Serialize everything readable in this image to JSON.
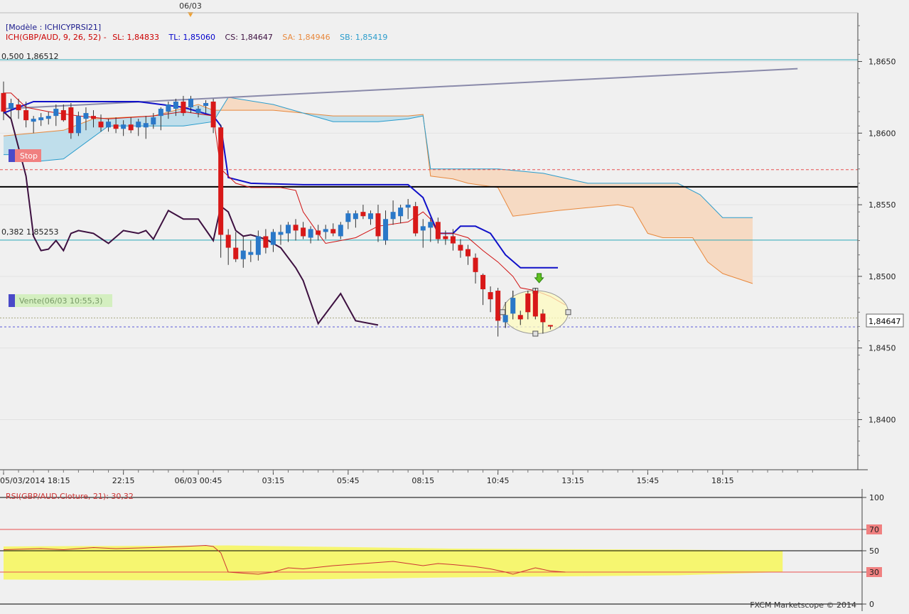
{
  "header": {
    "date_marker": "06/03",
    "model_label": "[Modèle : ICHICYPRSI21]",
    "ich_prefix": "ICH(GBP/AUD, 9, 26, 52) -",
    "sl": "SL: 1,84833",
    "tl": "TL: 1,85060",
    "cs": "CS: 1,84647",
    "sa": "SA: 1,84946",
    "sb": "SB: 1,85419"
  },
  "fib_levels": [
    {
      "label": "0,500 1,86512",
      "price": 1.86512
    },
    {
      "label": "0,382 1,85253",
      "price": 1.85253
    }
  ],
  "tags": {
    "stop": "Stop",
    "vente": "Vente(06/03 10:55,3)"
  },
  "chart_data": {
    "type": "candlestick",
    "y_axis": {
      "ticks": [
        "1,8650",
        "1,8600",
        "1,8550",
        "1,8500",
        "1,8450",
        "1,8400"
      ],
      "tick_values": [
        1.865,
        1.86,
        1.855,
        1.85,
        1.845,
        1.84
      ],
      "current_price_label": "1,84647",
      "current_price": 1.84647,
      "range": [
        1.8365,
        1.8684
      ]
    },
    "x_axis": {
      "ticks": [
        "05/03/2014 18:15",
        "22:15",
        "06/03 00:45",
        "03:15",
        "05:45",
        "08:15",
        "10:45",
        "13:15",
        "15:45",
        "18:15"
      ],
      "tick_index": [
        0,
        16,
        26,
        36,
        46,
        56,
        66,
        76,
        86,
        96
      ]
    },
    "levels": {
      "stop": 1.85745,
      "black_line": 1.85625,
      "vente": 1.8471,
      "current": 1.84647
    },
    "candles": [
      {
        "o": 1.8628,
        "h": 1.8636,
        "l": 1.8609,
        "c": 1.8615
      },
      {
        "o": 1.8617,
        "h": 1.8624,
        "l": 1.8609,
        "c": 1.8621
      },
      {
        "o": 1.862,
        "h": 1.8624,
        "l": 1.861,
        "c": 1.8616
      },
      {
        "o": 1.8616,
        "h": 1.8622,
        "l": 1.8604,
        "c": 1.8609
      },
      {
        "o": 1.8608,
        "h": 1.8612,
        "l": 1.86,
        "c": 1.861
      },
      {
        "o": 1.8609,
        "h": 1.8614,
        "l": 1.8605,
        "c": 1.8611
      },
      {
        "o": 1.861,
        "h": 1.8615,
        "l": 1.8606,
        "c": 1.8612
      },
      {
        "o": 1.8612,
        "h": 1.862,
        "l": 1.8605,
        "c": 1.8617
      },
      {
        "o": 1.8616,
        "h": 1.862,
        "l": 1.8608,
        "c": 1.8609
      },
      {
        "o": 1.8618,
        "h": 1.8621,
        "l": 1.8596,
        "c": 1.86
      },
      {
        "o": 1.86,
        "h": 1.8615,
        "l": 1.8598,
        "c": 1.8612
      },
      {
        "o": 1.861,
        "h": 1.8618,
        "l": 1.8602,
        "c": 1.8614
      },
      {
        "o": 1.8612,
        "h": 1.8616,
        "l": 1.8604,
        "c": 1.861
      },
      {
        "o": 1.8608,
        "h": 1.8613,
        "l": 1.8601,
        "c": 1.8604
      },
      {
        "o": 1.8604,
        "h": 1.861,
        "l": 1.8601,
        "c": 1.8608
      },
      {
        "o": 1.8606,
        "h": 1.8611,
        "l": 1.86,
        "c": 1.8603
      },
      {
        "o": 1.8603,
        "h": 1.8609,
        "l": 1.8598,
        "c": 1.8606
      },
      {
        "o": 1.8606,
        "h": 1.8611,
        "l": 1.86,
        "c": 1.8602
      },
      {
        "o": 1.8604,
        "h": 1.861,
        "l": 1.8598,
        "c": 1.8608
      },
      {
        "o": 1.8604,
        "h": 1.8612,
        "l": 1.8596,
        "c": 1.8607
      },
      {
        "o": 1.8606,
        "h": 1.8614,
        "l": 1.8603,
        "c": 1.8611
      },
      {
        "o": 1.8612,
        "h": 1.8618,
        "l": 1.8602,
        "c": 1.8617
      },
      {
        "o": 1.8615,
        "h": 1.8622,
        "l": 1.861,
        "c": 1.862
      },
      {
        "o": 1.8617,
        "h": 1.8624,
        "l": 1.8612,
        "c": 1.8622
      },
      {
        "o": 1.8622,
        "h": 1.8626,
        "l": 1.8612,
        "c": 1.8614
      },
      {
        "o": 1.8618,
        "h": 1.8626,
        "l": 1.8614,
        "c": 1.8624
      },
      {
        "o": 1.8614,
        "h": 1.8619,
        "l": 1.8611,
        "c": 1.8617
      },
      {
        "o": 1.8619,
        "h": 1.8623,
        "l": 1.8614,
        "c": 1.8621
      },
      {
        "o": 1.8622,
        "h": 1.8624,
        "l": 1.86,
        "c": 1.8604
      },
      {
        "o": 1.8604,
        "h": 1.8606,
        "l": 1.8513,
        "c": 1.8529
      },
      {
        "o": 1.8529,
        "h": 1.8533,
        "l": 1.8508,
        "c": 1.852
      },
      {
        "o": 1.852,
        "h": 1.8531,
        "l": 1.851,
        "c": 1.8512
      },
      {
        "o": 1.8512,
        "h": 1.8528,
        "l": 1.8506,
        "c": 1.8518
      },
      {
        "o": 1.8515,
        "h": 1.8525,
        "l": 1.851,
        "c": 1.8517
      },
      {
        "o": 1.8515,
        "h": 1.8532,
        "l": 1.8511,
        "c": 1.8528
      },
      {
        "o": 1.8528,
        "h": 1.8533,
        "l": 1.8516,
        "c": 1.852
      },
      {
        "o": 1.8522,
        "h": 1.8533,
        "l": 1.8517,
        "c": 1.8531
      },
      {
        "o": 1.8529,
        "h": 1.8536,
        "l": 1.8522,
        "c": 1.8531
      },
      {
        "o": 1.853,
        "h": 1.8538,
        "l": 1.8524,
        "c": 1.8536
      },
      {
        "o": 1.8536,
        "h": 1.854,
        "l": 1.8525,
        "c": 1.8532
      },
      {
        "o": 1.8534,
        "h": 1.8538,
        "l": 1.8526,
        "c": 1.8528
      },
      {
        "o": 1.8527,
        "h": 1.8535,
        "l": 1.8523,
        "c": 1.8533
      },
      {
        "o": 1.8532,
        "h": 1.8536,
        "l": 1.8525,
        "c": 1.8529
      },
      {
        "o": 1.8531,
        "h": 1.8536,
        "l": 1.8526,
        "c": 1.8533
      },
      {
        "o": 1.8533,
        "h": 1.8537,
        "l": 1.8528,
        "c": 1.853
      },
      {
        "o": 1.8528,
        "h": 1.8538,
        "l": 1.8526,
        "c": 1.8536
      },
      {
        "o": 1.8538,
        "h": 1.8546,
        "l": 1.8533,
        "c": 1.8544
      },
      {
        "o": 1.854,
        "h": 1.8546,
        "l": 1.8534,
        "c": 1.8544
      },
      {
        "o": 1.8545,
        "h": 1.855,
        "l": 1.854,
        "c": 1.8542
      },
      {
        "o": 1.854,
        "h": 1.8546,
        "l": 1.8536,
        "c": 1.8544
      },
      {
        "o": 1.8544,
        "h": 1.855,
        "l": 1.8524,
        "c": 1.8528
      },
      {
        "o": 1.8525,
        "h": 1.8546,
        "l": 1.8522,
        "c": 1.854
      },
      {
        "o": 1.854,
        "h": 1.8553,
        "l": 1.8536,
        "c": 1.8545
      },
      {
        "o": 1.8542,
        "h": 1.855,
        "l": 1.8537,
        "c": 1.8548
      },
      {
        "o": 1.8548,
        "h": 1.8554,
        "l": 1.854,
        "c": 1.855
      },
      {
        "o": 1.8549,
        "h": 1.8552,
        "l": 1.8528,
        "c": 1.853
      },
      {
        "o": 1.8532,
        "h": 1.854,
        "l": 1.852,
        "c": 1.8535
      },
      {
        "o": 1.8534,
        "h": 1.8541,
        "l": 1.8524,
        "c": 1.8538
      },
      {
        "o": 1.8538,
        "h": 1.8541,
        "l": 1.8523,
        "c": 1.8526
      },
      {
        "o": 1.8528,
        "h": 1.8532,
        "l": 1.8522,
        "c": 1.8526
      },
      {
        "o": 1.8528,
        "h": 1.8533,
        "l": 1.8518,
        "c": 1.8523
      },
      {
        "o": 1.8522,
        "h": 1.8526,
        "l": 1.8513,
        "c": 1.8518
      },
      {
        "o": 1.8519,
        "h": 1.8522,
        "l": 1.8508,
        "c": 1.8514
      },
      {
        "o": 1.8513,
        "h": 1.8516,
        "l": 1.8495,
        "c": 1.8503
      },
      {
        "o": 1.8501,
        "h": 1.8502,
        "l": 1.848,
        "c": 1.8491
      },
      {
        "o": 1.8489,
        "h": 1.8493,
        "l": 1.8475,
        "c": 1.8484
      },
      {
        "o": 1.849,
        "h": 1.8492,
        "l": 1.8458,
        "c": 1.8469
      },
      {
        "o": 1.8468,
        "h": 1.8482,
        "l": 1.8464,
        "c": 1.8473
      },
      {
        "o": 1.8474,
        "h": 1.849,
        "l": 1.847,
        "c": 1.8485
      },
      {
        "o": 1.8473,
        "h": 1.8476,
        "l": 1.8466,
        "c": 1.847
      },
      {
        "o": 1.8488,
        "h": 1.849,
        "l": 1.847,
        "c": 1.8475
      },
      {
        "o": 1.849,
        "h": 1.8492,
        "l": 1.847,
        "c": 1.8472
      },
      {
        "o": 1.8474,
        "h": 1.8477,
        "l": 1.846,
        "c": 1.8468
      },
      {
        "o": 1.8466,
        "h": 1.8466,
        "l": 1.8463,
        "c": 1.8465
      }
    ],
    "tenkan": [
      [
        0,
        1.8628
      ],
      [
        1,
        1.8628
      ],
      [
        2,
        1.8623
      ],
      [
        3,
        1.8618
      ],
      [
        6,
        1.8615
      ],
      [
        10,
        1.8612
      ],
      [
        14,
        1.861
      ],
      [
        20,
        1.8612
      ],
      [
        24,
        1.8615
      ],
      [
        28,
        1.8612
      ],
      [
        29,
        1.8575
      ],
      [
        31,
        1.8565
      ],
      [
        33,
        1.8562
      ],
      [
        36,
        1.8562
      ],
      [
        37,
        1.8562
      ],
      [
        39,
        1.856
      ],
      [
        40,
        1.8545
      ],
      [
        42,
        1.853
      ],
      [
        43,
        1.8523
      ],
      [
        47,
        1.8527
      ],
      [
        50,
        1.8535
      ],
      [
        54,
        1.8538
      ],
      [
        56,
        1.8545
      ],
      [
        57,
        1.854
      ],
      [
        58,
        1.853
      ],
      [
        60,
        1.853
      ],
      [
        62,
        1.8527
      ],
      [
        64,
        1.8518
      ],
      [
        66,
        1.851
      ],
      [
        68,
        1.85
      ],
      [
        69,
        1.8492
      ],
      [
        71,
        1.849
      ],
      [
        73,
        1.8486
      ],
      [
        75,
        1.848
      ]
    ],
    "kijun": [
      [
        0,
        1.8614
      ],
      [
        4,
        1.8622
      ],
      [
        12,
        1.8622
      ],
      [
        18,
        1.8622
      ],
      [
        24,
        1.8618
      ],
      [
        28,
        1.8612
      ],
      [
        29,
        1.8605
      ],
      [
        30,
        1.8569
      ],
      [
        33,
        1.8565
      ],
      [
        40,
        1.8564
      ],
      [
        50,
        1.8564
      ],
      [
        54,
        1.8564
      ],
      [
        56,
        1.8555
      ],
      [
        58,
        1.853
      ],
      [
        60,
        1.853
      ],
      [
        61,
        1.8535
      ],
      [
        63,
        1.8535
      ],
      [
        65,
        1.853
      ],
      [
        67,
        1.8515
      ],
      [
        69,
        1.8506
      ],
      [
        74,
        1.8506
      ]
    ],
    "chikou": [
      [
        0,
        1.8615
      ],
      [
        1,
        1.861
      ],
      [
        3,
        1.857
      ],
      [
        4,
        1.8528
      ],
      [
        5,
        1.8518
      ],
      [
        6,
        1.8519
      ],
      [
        7,
        1.8525
      ],
      [
        8,
        1.8518
      ],
      [
        9,
        1.853
      ],
      [
        10,
        1.8532
      ],
      [
        12,
        1.853
      ],
      [
        14,
        1.8523
      ],
      [
        16,
        1.8532
      ],
      [
        18,
        1.853
      ],
      [
        19,
        1.8532
      ],
      [
        20,
        1.8526
      ],
      [
        22,
        1.8546
      ],
      [
        24,
        1.854
      ],
      [
        26,
        1.854
      ],
      [
        28,
        1.8525
      ],
      [
        29,
        1.8549
      ],
      [
        30,
        1.8545
      ],
      [
        31,
        1.8532
      ],
      [
        32,
        1.8528
      ],
      [
        33,
        1.8529
      ],
      [
        35,
        1.8526
      ],
      [
        37,
        1.852
      ],
      [
        39,
        1.8506
      ],
      [
        40,
        1.8497
      ],
      [
        42,
        1.8467
      ],
      [
        45,
        1.8488
      ],
      [
        47,
        1.8469
      ],
      [
        50,
        1.8466
      ]
    ],
    "senkou_a": [
      [
        0,
        1.8598
      ],
      [
        8,
        1.8602
      ],
      [
        12,
        1.861
      ],
      [
        20,
        1.8612
      ],
      [
        26,
        1.862
      ],
      [
        28,
        1.8616
      ],
      [
        36,
        1.8616
      ],
      [
        44,
        1.8612
      ],
      [
        54,
        1.8612
      ],
      [
        56,
        1.8613
      ],
      [
        57,
        1.857
      ],
      [
        60,
        1.8568
      ],
      [
        62,
        1.8565
      ],
      [
        66,
        1.8562
      ],
      [
        68,
        1.8542
      ],
      [
        74,
        1.8546
      ],
      [
        82,
        1.855
      ],
      [
        84,
        1.8548
      ],
      [
        86,
        1.853
      ],
      [
        88,
        1.8527
      ],
      [
        92,
        1.8527
      ],
      [
        94,
        1.851
      ],
      [
        96,
        1.8502
      ],
      [
        100,
        1.8495
      ]
    ],
    "senkou_b": [
      [
        0,
        1.8585
      ],
      [
        2,
        1.8585
      ],
      [
        4,
        1.858
      ],
      [
        8,
        1.8582
      ],
      [
        14,
        1.8605
      ],
      [
        24,
        1.8605
      ],
      [
        28,
        1.8608
      ],
      [
        30,
        1.8625
      ],
      [
        36,
        1.862
      ],
      [
        44,
        1.8608
      ],
      [
        50,
        1.8608
      ],
      [
        54,
        1.861
      ],
      [
        56,
        1.8612
      ],
      [
        57,
        1.8575
      ],
      [
        62,
        1.8575
      ],
      [
        66,
        1.8575
      ],
      [
        68,
        1.8574
      ],
      [
        72,
        1.8572
      ],
      [
        78,
        1.8565
      ],
      [
        84,
        1.8565
      ],
      [
        90,
        1.8565
      ],
      [
        93,
        1.8557
      ],
      [
        96,
        1.8541
      ],
      [
        100,
        1.8541
      ]
    ],
    "trend_line": [
      [
        0,
        1.8617
      ],
      [
        106,
        1.8645
      ]
    ],
    "rsi": {
      "label": "RSI(GBP/AUD.Cloture, 21): 30,32",
      "value": 30.32,
      "ticks": [
        "100",
        "70",
        "50",
        "30",
        "0"
      ],
      "tick_values": [
        100,
        70,
        50,
        30,
        0
      ],
      "series": [
        [
          0,
          51
        ],
        [
          5,
          52
        ],
        [
          8,
          51
        ],
        [
          12,
          53
        ],
        [
          15,
          52
        ],
        [
          20,
          53
        ],
        [
          24,
          54
        ],
        [
          27,
          55
        ],
        [
          28,
          54
        ],
        [
          29,
          48
        ],
        [
          30,
          30
        ],
        [
          32,
          29
        ],
        [
          34,
          28
        ],
        [
          36,
          30
        ],
        [
          38,
          34
        ],
        [
          40,
          33
        ],
        [
          44,
          36
        ],
        [
          48,
          38
        ],
        [
          52,
          40
        ],
        [
          56,
          36
        ],
        [
          58,
          38
        ],
        [
          60,
          37
        ],
        [
          63,
          35
        ],
        [
          65,
          33
        ],
        [
          67,
          30
        ],
        [
          68,
          28
        ],
        [
          70,
          32
        ],
        [
          71,
          34
        ],
        [
          73,
          31
        ],
        [
          75,
          30
        ]
      ],
      "band": [
        [
          0,
          54,
          23
        ],
        [
          30,
          55,
          22
        ],
        [
          60,
          52,
          25
        ],
        [
          90,
          51,
          27
        ],
        [
          104,
          50,
          30
        ]
      ]
    }
  },
  "watermark": "FXCM Marketscope © 2014"
}
